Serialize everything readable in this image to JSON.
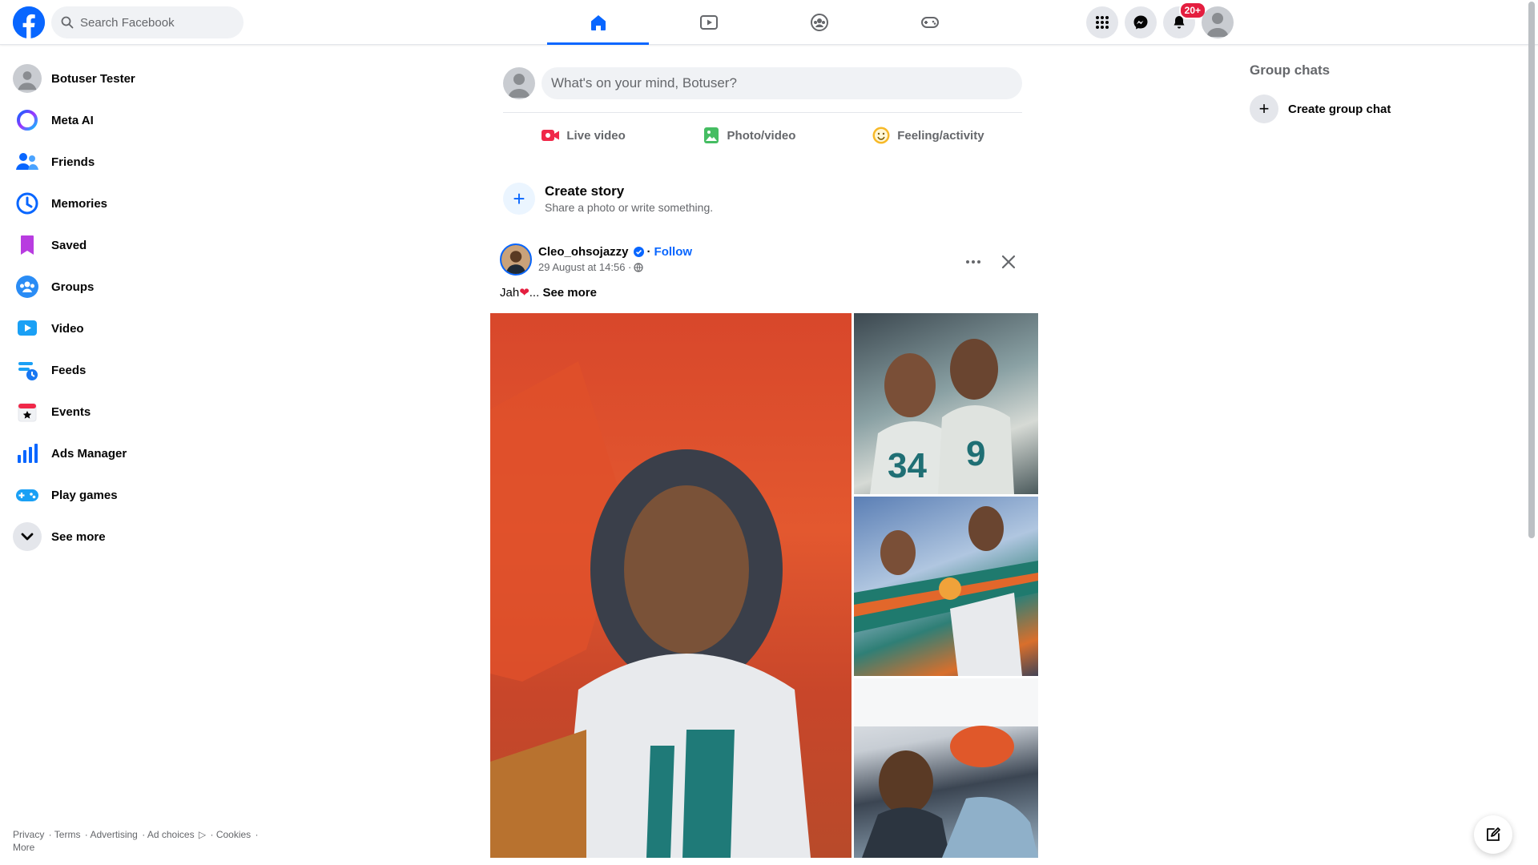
{
  "header": {
    "search_placeholder": "Search Facebook",
    "notifications_badge": "20+",
    "nav_tabs": [
      "home-icon",
      "video-icon",
      "groups-icon",
      "gaming-icon"
    ],
    "active_tab": "home"
  },
  "sidebar": {
    "items": [
      {
        "label": "Botuser Tester",
        "icon": "profile-avatar"
      },
      {
        "label": "Meta AI",
        "icon": "meta-ai-icon"
      },
      {
        "label": "Friends",
        "icon": "friends-icon"
      },
      {
        "label": "Memories",
        "icon": "memories-icon"
      },
      {
        "label": "Saved",
        "icon": "saved-icon"
      },
      {
        "label": "Groups",
        "icon": "groups-icon"
      },
      {
        "label": "Video",
        "icon": "video-icon"
      },
      {
        "label": "Feeds",
        "icon": "feeds-icon"
      },
      {
        "label": "Events",
        "icon": "events-icon"
      },
      {
        "label": "Ads Manager",
        "icon": "ads-manager-icon"
      },
      {
        "label": "Play games",
        "icon": "play-games-icon"
      },
      {
        "label": "See more",
        "icon": "chevron-down-icon"
      }
    ]
  },
  "footer": {
    "privacy": "Privacy",
    "terms": "Terms",
    "advertising": "Advertising",
    "ad_choices": "Ad choices",
    "cookies": "Cookies",
    "more": "More"
  },
  "composer": {
    "placeholder": "What's on your mind, Botuser?",
    "live_video": "Live video",
    "photo_video": "Photo/video",
    "feeling": "Feeling/activity"
  },
  "story": {
    "title": "Create story",
    "subtitle": "Share a photo or write something."
  },
  "post": {
    "author": "Cleo_ohsojazzy",
    "follow": "Follow",
    "timestamp": "29 August at 14:56",
    "text": "Jah",
    "see_more": "See more"
  },
  "right": {
    "group_chats_title": "Group chats",
    "create_group_chat": "Create group chat"
  },
  "colors": {
    "brand": "#0866ff",
    "badge": "#e41e3f",
    "secondary_text": "#65676b"
  }
}
